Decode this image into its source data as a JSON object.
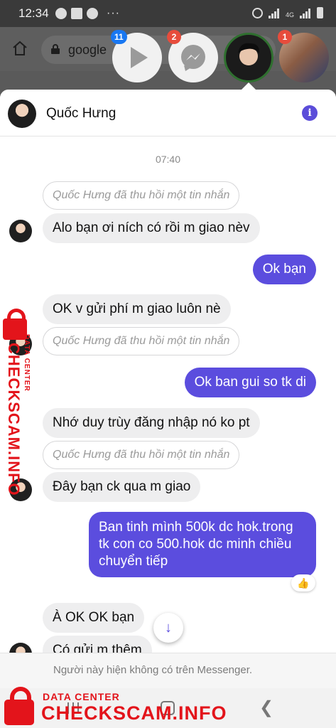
{
  "status_bar": {
    "time": "12:34",
    "more": "···",
    "network_label": "4G"
  },
  "browser": {
    "url_text": "google"
  },
  "chat_heads": [
    {
      "name": "play-head",
      "badge": "11",
      "badge_color": "#1877f2"
    },
    {
      "name": "messenger-head",
      "badge": "2",
      "badge_color": "#e74c3c"
    },
    {
      "name": "user-head",
      "badge": ""
    },
    {
      "name": "photo-head",
      "badge": "1",
      "badge_color": "#e74c3c"
    }
  ],
  "chat": {
    "contact_name": "Quốc Hưng",
    "timestamp": "07:40",
    "recalled_text": "Quốc Hưng đã thu hồi một tin nhắn",
    "messages": [
      {
        "from": "them",
        "type": "recalled"
      },
      {
        "from": "them",
        "text": "Alo bạn ơi ních có rồi m giao nèv"
      },
      {
        "from": "me",
        "text": "Ok bạn"
      },
      {
        "from": "them",
        "text": "OK v gửi phí m giao luôn nè"
      },
      {
        "from": "them",
        "type": "recalled"
      },
      {
        "from": "me",
        "text": "Ok ban gui so tk di"
      },
      {
        "from": "them",
        "text": "Nhớ duy trùy đăng nhập nó ko pt"
      },
      {
        "from": "them",
        "type": "recalled"
      },
      {
        "from": "them",
        "text": "Đây bạn ck qua m giao"
      },
      {
        "from": "me",
        "lines": [
          "Ban tinh mình 500k dc hok.trong",
          "tk con co 500.hok dc minh chiều",
          "chuyển tiếp"
        ],
        "reaction": "👍"
      },
      {
        "from": "them",
        "text": "À OK OK bạn"
      },
      {
        "from": "them",
        "text": "Có gửi m thêm"
      }
    ],
    "unavailable_notice": "Người này hiện không có trên Messenger."
  },
  "watermark": {
    "small": "DATA CENTER",
    "large": "CHECKSCAM.INFO",
    "color": "#e3141b"
  },
  "colors": {
    "outgoing_bubble": "#5b4dde",
    "incoming_bubble": "#eeeeef"
  }
}
